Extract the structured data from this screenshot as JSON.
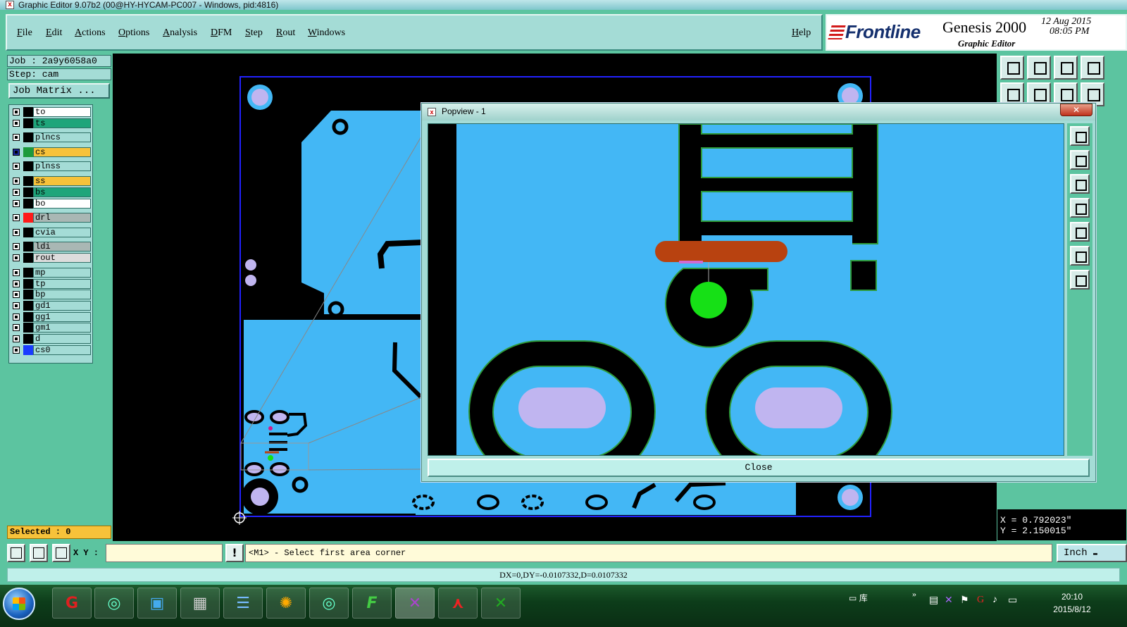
{
  "window": {
    "title": "Graphic Editor 9.07b2 (00@HY-HYCAM-PC007 - Windows, pid:4816)"
  },
  "menu": {
    "items": [
      "File",
      "Edit",
      "Actions",
      "Options",
      "Analysis",
      "DFM",
      "Step",
      "Rout",
      "Windows"
    ],
    "help": "Help"
  },
  "brand": {
    "logo": "Frontline",
    "product": "Genesis 2000",
    "subtitle": "Graphic Editor",
    "date": "12 Aug 2015",
    "time": "08:05 PM"
  },
  "job": {
    "job_label": "Job : 2a9y6058a0",
    "step_label": "Step: cam",
    "matrix_button": "Job Matrix ..."
  },
  "layers": [
    {
      "name": "to",
      "swatch": "#000000",
      "bg": "#ffffff"
    },
    {
      "name": "ts",
      "swatch": "#000000",
      "bg": "#1ea57a"
    },
    {
      "name": "plncs",
      "swatch": "#000000",
      "bg": "#a4dcd6"
    },
    {
      "name": "cs",
      "swatch": "#1d9a3c",
      "bg": "#f7c23a",
      "active": true
    },
    {
      "name": "plnss",
      "swatch": "#000000",
      "bg": "#a4dcd6"
    },
    {
      "name": "ss",
      "swatch": "#000000",
      "bg": "#f7c23a"
    },
    {
      "name": "bs",
      "swatch": "#000000",
      "bg": "#1ea57a"
    },
    {
      "name": "bo",
      "swatch": "#000000",
      "bg": "#ffffff"
    },
    {
      "name": "drl",
      "swatch": "#ff1a1a",
      "bg": "#a9b7b4"
    },
    {
      "name": "cvia",
      "swatch": "#000000",
      "bg": "#a4dcd6"
    },
    {
      "name": "ldi",
      "swatch": "#000000",
      "bg": "#a9b7b4"
    },
    {
      "name": "rout",
      "swatch": "#000000",
      "bg": "#dcdcdc"
    },
    {
      "name": "mp",
      "swatch": "#000000",
      "bg": "#a4dcd6"
    },
    {
      "name": "tp",
      "swatch": "#000000",
      "bg": "#a4dcd6"
    },
    {
      "name": "bp",
      "swatch": "#000000",
      "bg": "#a4dcd6"
    },
    {
      "name": "gd1",
      "swatch": "#000000",
      "bg": "#a4dcd6"
    },
    {
      "name": "gg1",
      "swatch": "#000000",
      "bg": "#a4dcd6"
    },
    {
      "name": "gm1",
      "swatch": "#000000",
      "bg": "#a4dcd6"
    },
    {
      "name": "d",
      "swatch": "#000000",
      "bg": "#a4dcd6"
    },
    {
      "name": "cs0",
      "swatch": "#1a3cff",
      "bg": "#a4dcd6"
    }
  ],
  "selected": "Selected : 0",
  "coords": {
    "x": "X = 0.792023\"",
    "y": "Y = 2.150015\""
  },
  "input": {
    "xy_label": "X Y :",
    "xy_value": "",
    "prompt": "<M1> - Select first area corner",
    "unit": "Inch"
  },
  "status": "DX=0,DY=-0.0107332,D=0.0107332",
  "popview": {
    "title": "Popview - 1",
    "close_x": "✕",
    "close_button": "Close"
  },
  "taskbar": {
    "apps": [
      "genesis-icon",
      "cam-icon",
      "save-icon",
      "calculator-icon",
      "notepad-icon",
      "shell-icon",
      "cam2-icon",
      "frontline-icon",
      "editor-icon",
      "pdf-icon",
      "excel-icon"
    ],
    "tray_label": "库",
    "clock_time": "20:10",
    "clock_date": "2015/8/12"
  },
  "colors": {
    "pcb_copper": "#43b7f5",
    "board_black": "#000000",
    "pad_lilac": "#c0b5f0",
    "via_green": "#16e016",
    "trace_orange": "#b84210",
    "outline_green": "#2e9a3a",
    "frame_teal": "#5cc4a0"
  }
}
